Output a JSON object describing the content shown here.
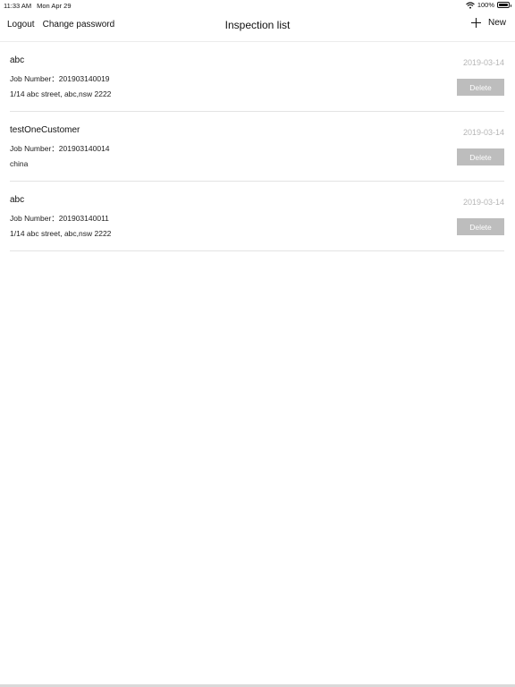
{
  "status_bar": {
    "time": "11:33 AM",
    "date": "Mon Apr 29",
    "battery": "100%"
  },
  "nav": {
    "logout_label": "Logout",
    "change_password_label": "Change password",
    "title": "Inspection list",
    "new_label": "New"
  },
  "inspections": [
    {
      "name": "abc",
      "job_number": "Job Number：201903140019",
      "address": "1/14 abc street, abc,nsw 2222",
      "date": "2019-03-14",
      "delete_label": "Delete"
    },
    {
      "name": "testOneCustomer",
      "job_number": "Job Number：201903140014",
      "address": "china",
      "date": "2019-03-14",
      "delete_label": "Delete"
    },
    {
      "name": "abc",
      "job_number": "Job Number：201903140011",
      "address": "1/14 abc street, abc,nsw 2222",
      "date": "2019-03-14",
      "delete_label": "Delete"
    }
  ],
  "icons": {
    "wifi": "wifi-icon",
    "battery": "battery-icon",
    "add": "plus-icon"
  }
}
